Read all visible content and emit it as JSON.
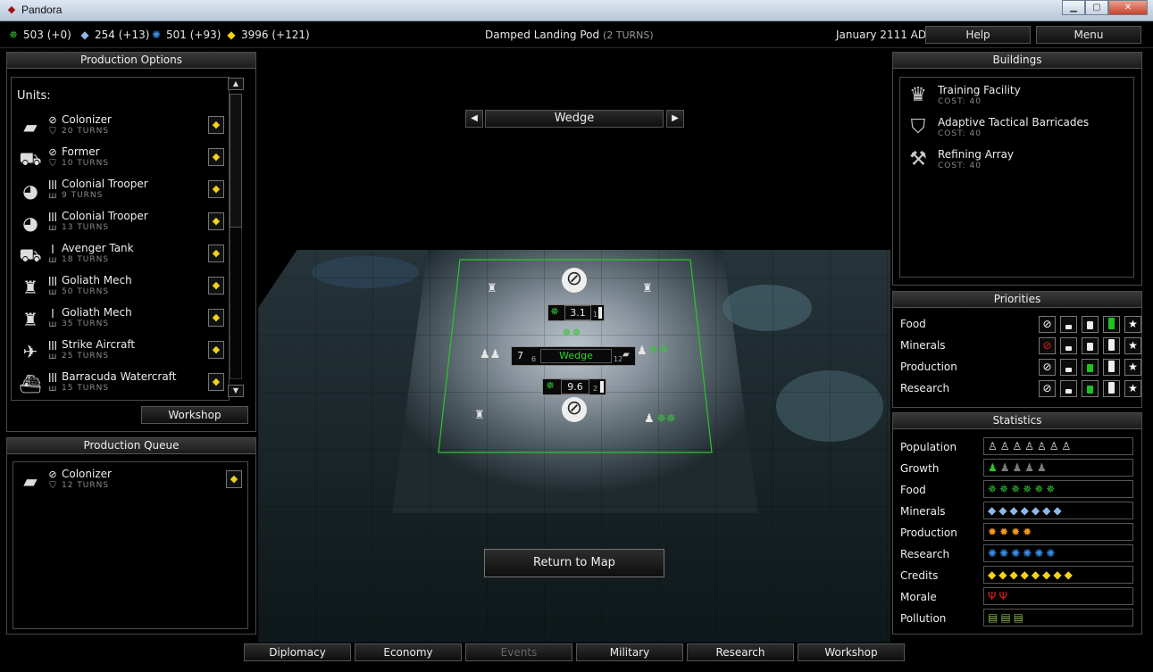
{
  "window": {
    "title": "Pandora",
    "minimize": "▁",
    "maximize": "▢",
    "close": "✕"
  },
  "resources": [
    {
      "icon": "nutrient-icon",
      "glyph": "✵",
      "color": "#38c43a",
      "text": "503 (+0)"
    },
    {
      "icon": "mineral-icon",
      "glyph": "◆",
      "color": "#8fb8e8",
      "text": "254 (+13)"
    },
    {
      "icon": "research-icon",
      "glyph": "✺",
      "color": "#3a8ee6",
      "text": "501 (+93)"
    },
    {
      "icon": "credits-icon",
      "glyph": "◆",
      "color": "#f2d21b",
      "text": "3996 (+121)"
    }
  ],
  "status": {
    "name": "Damped Landing Pod",
    "turns": "(2 TURNS)"
  },
  "date": "January 2111 AD",
  "top_buttons": {
    "help": "Help",
    "menu": "Menu"
  },
  "production_options": {
    "title": "Production Options",
    "units_header": "Units:",
    "units": [
      {
        "name": "Colonizer",
        "turns": "20 TURNS",
        "glyph": "▰",
        "s1": "⊘",
        "s2": "⛉"
      },
      {
        "name": "Former",
        "turns": "10 TURNS",
        "glyph": "⛟",
        "s1": "⊘",
        "s2": "⛉"
      },
      {
        "name": "Colonial Trooper",
        "turns": "9 TURNS",
        "glyph": "◕",
        "s1": "ǀǀǀ",
        "s2": "ш"
      },
      {
        "name": "Colonial Trooper",
        "turns": "13 TURNS",
        "glyph": "◕",
        "s1": "ǀǀǀ",
        "s2": "ш"
      },
      {
        "name": "Avenger Tank",
        "turns": "18 TURNS",
        "glyph": "⛟",
        "s1": "ǀ",
        "s2": "ш"
      },
      {
        "name": "Goliath Mech",
        "turns": "50 TURNS",
        "glyph": "♜",
        "s1": "ǀǀǀ",
        "s2": "ш"
      },
      {
        "name": "Goliath Mech",
        "turns": "35 TURNS",
        "glyph": "♜",
        "s1": "ǀ",
        "s2": "ш"
      },
      {
        "name": "Strike Aircraft",
        "turns": "25 TURNS",
        "glyph": "✈",
        "s1": "ǀǀǀ",
        "s2": "ш"
      },
      {
        "name": "Barracuda Watercraft",
        "turns": "15 TURNS",
        "glyph": "⛴",
        "s1": "ǀǀǀ",
        "s2": "ш"
      }
    ],
    "buy_glyph": "◆",
    "workshop_button": "Workshop"
  },
  "production_queue": {
    "title": "Production Queue",
    "items": [
      {
        "name": "Colonizer",
        "turns": "12 TURNS",
        "glyph": "▰",
        "s1": "⊘",
        "s2": "⛉"
      }
    ]
  },
  "city": {
    "name": "Wedge",
    "prev": "◀",
    "next": "▶",
    "pop": "7",
    "pop_sub": "6",
    "right_sub": "12",
    "tile_top": "3.1",
    "tile_top_sub": "1",
    "tile_bottom": "9.6",
    "tile_bottom_sub": "2",
    "return_button": "Return to Map"
  },
  "buildings": {
    "title": "Buildings",
    "items": [
      {
        "name": "Training Facility",
        "cost": "COST: 40",
        "glyph": "♛"
      },
      {
        "name": "Adaptive Tactical Barricades",
        "cost": "COST: 40",
        "glyph": "⛉"
      },
      {
        "name": "Refining Array",
        "cost": "COST: 40",
        "glyph": "⚒"
      }
    ]
  },
  "priorities": {
    "title": "Priorities",
    "rows": [
      {
        "label": "Food",
        "selected": 3,
        "cancel_red": false
      },
      {
        "label": "Minerals",
        "selected": 0,
        "cancel_red": true
      },
      {
        "label": "Production",
        "selected": 2,
        "cancel_red": false
      },
      {
        "label": "Research",
        "selected": 2,
        "cancel_red": false
      }
    ],
    "cancel_glyph": "⊘",
    "star_glyph": "★"
  },
  "statistics": {
    "title": "Statistics",
    "rows": [
      {
        "label": "Population",
        "icons": "♙♙♙♙♙♙♙",
        "color": "#e8e8e8"
      },
      {
        "label": "Growth",
        "icons": "♟♟♟♟♟",
        "color": "#7a7a7a",
        "first_color": "#2fc12f"
      },
      {
        "label": "Food",
        "icons": "✵✵✵✵✵✵",
        "color": "#38c43a"
      },
      {
        "label": "Minerals",
        "icons": "◆◆◆◆◆◆◆",
        "color": "#8fb8e8"
      },
      {
        "label": "Production",
        "icons": "✹✹✹✹",
        "color": "#f39a1c"
      },
      {
        "label": "Research",
        "icons": "✺✺✺✺✺✺",
        "color": "#3a8ee6"
      },
      {
        "label": "Credits",
        "icons": "◆◆◆◆◆◆◆◆",
        "color": "#f2d21b"
      },
      {
        "label": "Morale",
        "icons": "ΨΨ",
        "color": "#e02020"
      },
      {
        "label": "Pollution",
        "icons": "▤▤▤",
        "color": "#86b34a"
      }
    ]
  },
  "tabs": [
    {
      "label": "Diplomacy",
      "enabled": true
    },
    {
      "label": "Economy",
      "enabled": true
    },
    {
      "label": "Events",
      "enabled": false
    },
    {
      "label": "Military",
      "enabled": true
    },
    {
      "label": "Research",
      "enabled": true
    },
    {
      "label": "Workshop",
      "enabled": true
    }
  ]
}
